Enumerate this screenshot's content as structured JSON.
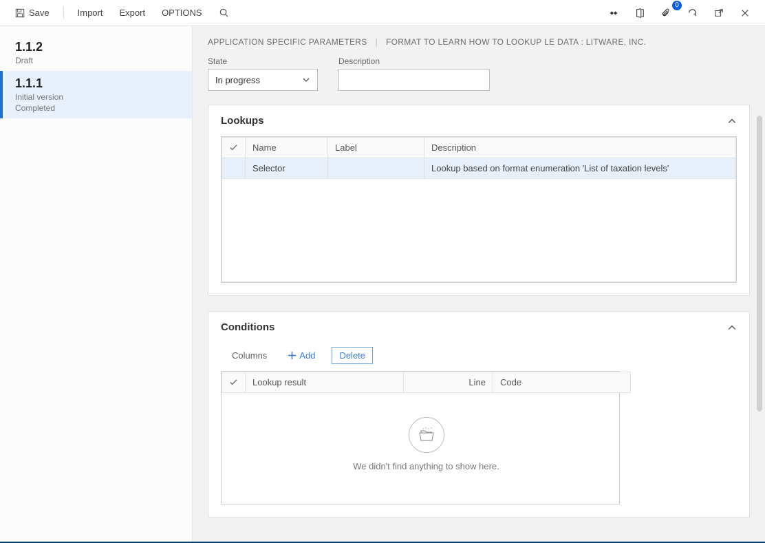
{
  "cmdbar": {
    "save": "Save",
    "import": "Import",
    "export": "Export",
    "options": "OPTIONS",
    "badge_count": "0"
  },
  "nav": {
    "items": [
      {
        "version": "1.1.2",
        "status": "Draft",
        "active": false
      },
      {
        "version": "1.1.1",
        "status": "Initial version",
        "status2": "Completed",
        "active": true
      }
    ]
  },
  "breadcrumb": {
    "left": "Application specific parameters",
    "right": "Format to learn how to lookup LE data : Litware, Inc."
  },
  "form": {
    "state_label": "State",
    "state_value": "In progress",
    "description_label": "Description",
    "description_value": ""
  },
  "lookups": {
    "title": "Lookups",
    "columns": {
      "name": "Name",
      "label": "Label",
      "description": "Description"
    },
    "rows": [
      {
        "name": "Selector",
        "label": "",
        "description": "Lookup based on format enumeration 'List of taxation levels'"
      }
    ]
  },
  "conditions": {
    "title": "Conditions",
    "toolbar": {
      "columns": "Columns",
      "add": "Add",
      "delete": "Delete"
    },
    "columns": {
      "lookup_result": "Lookup result",
      "line": "Line",
      "code": "Code"
    },
    "empty_text": "We didn't find anything to show here."
  }
}
